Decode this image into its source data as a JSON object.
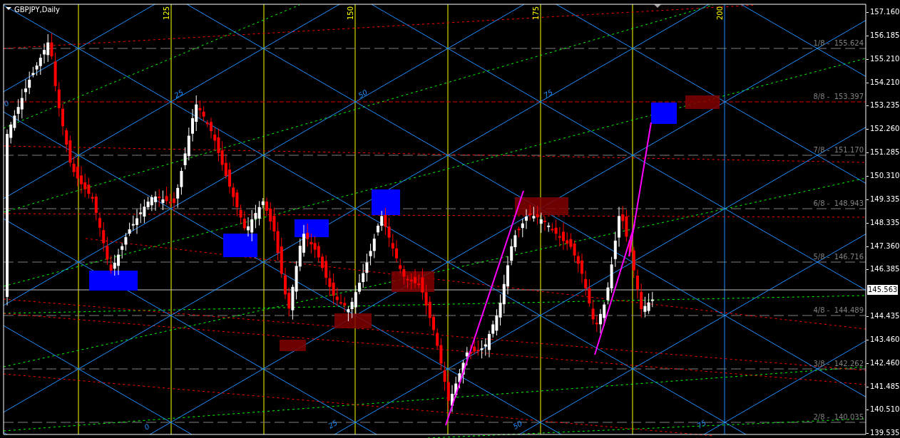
{
  "window": {
    "title": "GBPJPY,Daily"
  },
  "time_markers": [
    "125",
    "150",
    "175",
    "200"
  ],
  "murrey_levels": [
    {
      "label": "1/8 -  155.624"
    },
    {
      "label": "8/8 -  153.397"
    },
    {
      "label": "7/8 -  151.170"
    },
    {
      "label": "6/8 -  148.943"
    },
    {
      "label": "5/8 -  146.716"
    },
    {
      "label": "4/8 -  144.489"
    },
    {
      "label": "3/8 -  142.262"
    },
    {
      "label": "2/8 -  140.035"
    }
  ],
  "angle_labels": [
    "0",
    "25",
    "50",
    "75",
    "0",
    "25",
    "50",
    "75"
  ],
  "price_axis": {
    "ticks": [
      "157.160",
      "156.185",
      "155.210",
      "154.210",
      "153.235",
      "152.260",
      "151.285",
      "150.310",
      "149.335",
      "148.335",
      "147.360",
      "146.385",
      "144.435",
      "143.460",
      "142.460",
      "141.485",
      "140.510",
      "139.535"
    ],
    "current_price": "145.563"
  }
}
